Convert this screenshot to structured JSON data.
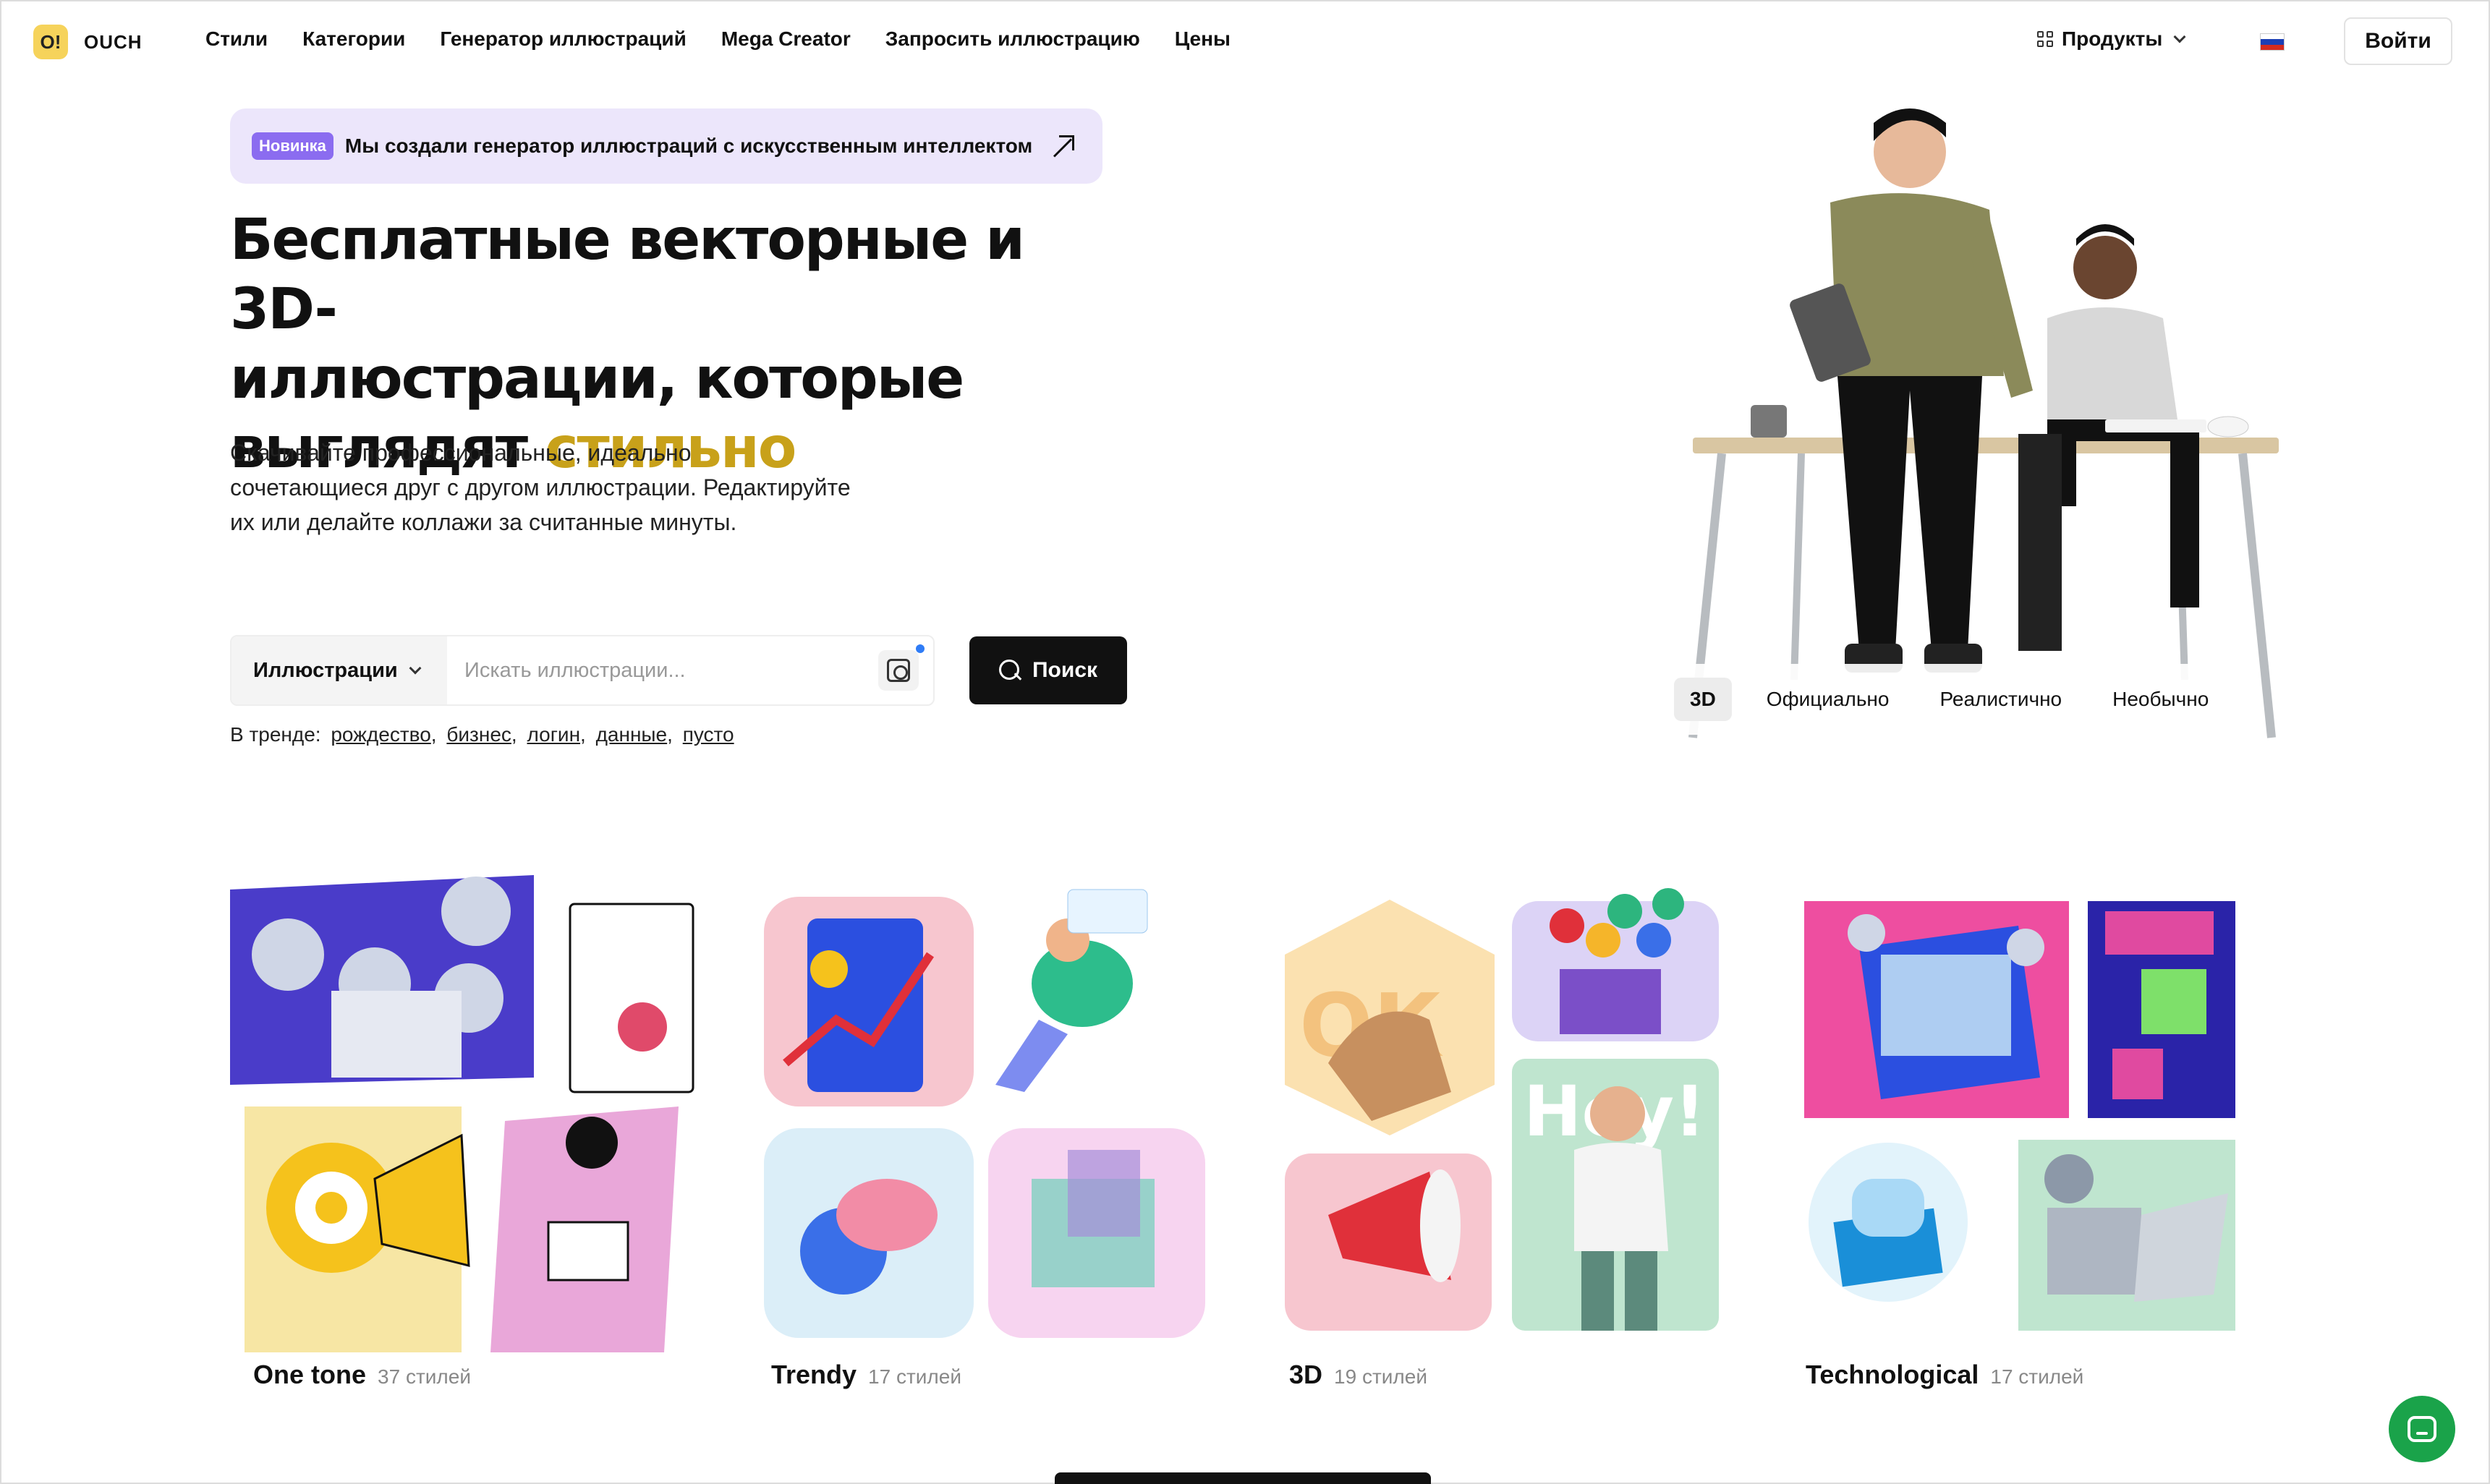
{
  "header": {
    "logo_mark": "O!",
    "logo_text": "OUCH",
    "nav": [
      "Стили",
      "Категории",
      "Генератор иллюстраций",
      "Mega Creator",
      "Запросить иллюстрацию",
      "Цены"
    ],
    "products_label": "Продукты",
    "login_label": "Войти"
  },
  "announcement": {
    "badge": "Новинка",
    "text": "Мы создали генератор иллюстраций с искусственным интеллектом"
  },
  "hero": {
    "title_line1": "Бесплатные векторные и 3D-",
    "title_line2": "иллюстрации, которые",
    "title_line3": "выглядят",
    "title_accent": "стильно",
    "subtitle": "Скачивайте профессиональные, идеально сочетающиеся друг с другом иллюстрации. Редактируйте их или делайте коллажи за считанные минуты."
  },
  "search": {
    "type_label": "Иллюстрации",
    "placeholder": "Искать иллюстрации...",
    "button_label": "Поиск"
  },
  "trends": {
    "prefix": "В тренде:",
    "items": [
      "рождество",
      "бизнес",
      "логин",
      "данные",
      "пусто"
    ]
  },
  "style_tabs": [
    "3D",
    "Официально",
    "Реалистично",
    "Необычно"
  ],
  "categories": [
    {
      "name": "One tone",
      "count": "37 стилей"
    },
    {
      "name": "Trendy",
      "count": "17 стилей"
    },
    {
      "name": "3D",
      "count": "19 стилей"
    },
    {
      "name": "Technological",
      "count": "17 стилей"
    }
  ],
  "colors": {
    "accent": "#c8a11a",
    "badge": "#8b6cf0",
    "announce_bg": "#ece6fb",
    "chat": "#1aa34a"
  }
}
